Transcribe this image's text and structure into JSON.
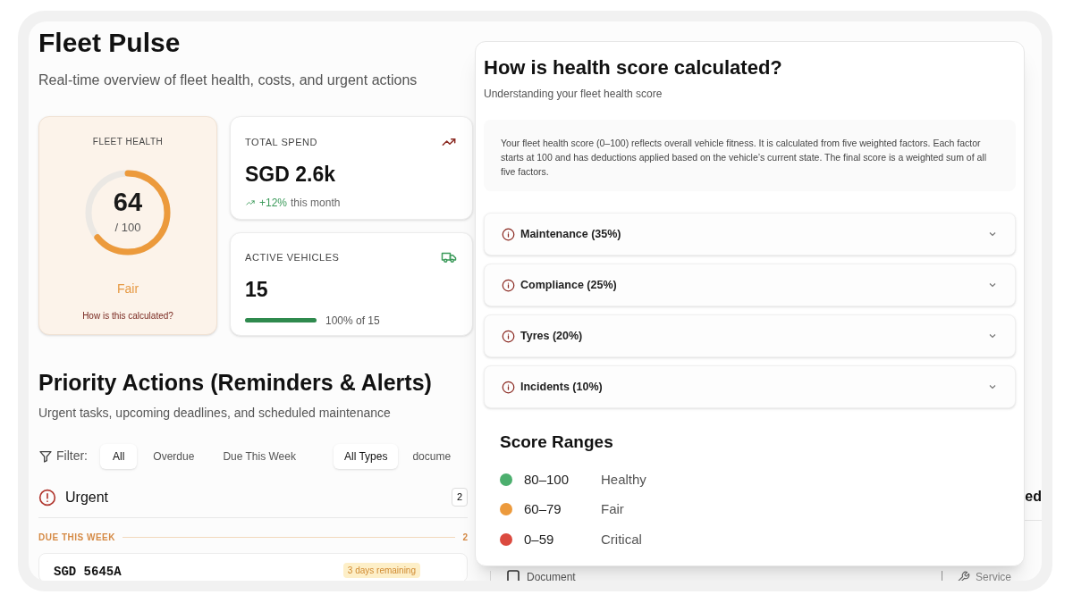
{
  "header": {
    "title": "Fleet Pulse",
    "subtitle": "Real-time overview of fleet health, costs, and urgent actions"
  },
  "fleet_health": {
    "label": "FLEET HEALTH",
    "score": "64",
    "max": "/ 100",
    "level": 0.64,
    "rating": "Fair",
    "link": "How is this calculated?"
  },
  "total_spend": {
    "label": "TOTAL SPEND",
    "value": "SGD 2.6k",
    "trend": "+12%",
    "trend_text": "this month"
  },
  "active_vehicles": {
    "label": "ACTIVE VEHICLES",
    "value": "15",
    "level": 1,
    "reading": "100% of 15"
  },
  "priority": {
    "title": "Priority Actions (Reminders & Alerts)",
    "subtitle": "Urgent tasks, upcoming deadlines, and scheduled maintenance",
    "filter_label": "Filter:",
    "status_filters": [
      {
        "label": "All",
        "selected": true
      },
      {
        "label": "Overdue",
        "selected": false
      },
      {
        "label": "Due This Week",
        "selected": false
      }
    ],
    "type_filters": [
      {
        "label": "All Types",
        "selected": true
      },
      {
        "label": "docume",
        "selected": false
      }
    ],
    "urgent": {
      "title": "Urgent",
      "count": "2"
    },
    "group": {
      "label": "DUE THIS WEEK",
      "count": "2"
    },
    "item": {
      "plate": "SGD 5645A",
      "badge": "3 days remaining"
    }
  },
  "background_panel": {
    "heading_fragment": "ed",
    "document": "Document",
    "service": "Service"
  },
  "health_popover": {
    "title": "How is health score calculated?",
    "subtitle": "Understanding your fleet health score",
    "description": "Your fleet health score (0–100) reflects overall vehicle fitness. It is calculated from five weighted factors. Each factor starts at 100 and has deductions applied based on the vehicle’s current state. The final score is a weighted sum of all five factors.",
    "factors": [
      {
        "label": "Maintenance (35%)",
        "expanded": false
      },
      {
        "label": "Compliance (25%)",
        "expanded": false
      },
      {
        "label": "Tyres (20%)",
        "expanded": false
      },
      {
        "label": "Incidents (10%)",
        "expanded": false
      }
    ],
    "ranges_title": "Score Ranges",
    "ranges": [
      {
        "range": "80–100",
        "label": "Healthy",
        "color": "#4caf6e"
      },
      {
        "range": "60–79",
        "label": "Fair",
        "color": "#ec9a3c"
      },
      {
        "range": "0–59",
        "label": "Critical",
        "color": "#db4a3f"
      }
    ]
  }
}
